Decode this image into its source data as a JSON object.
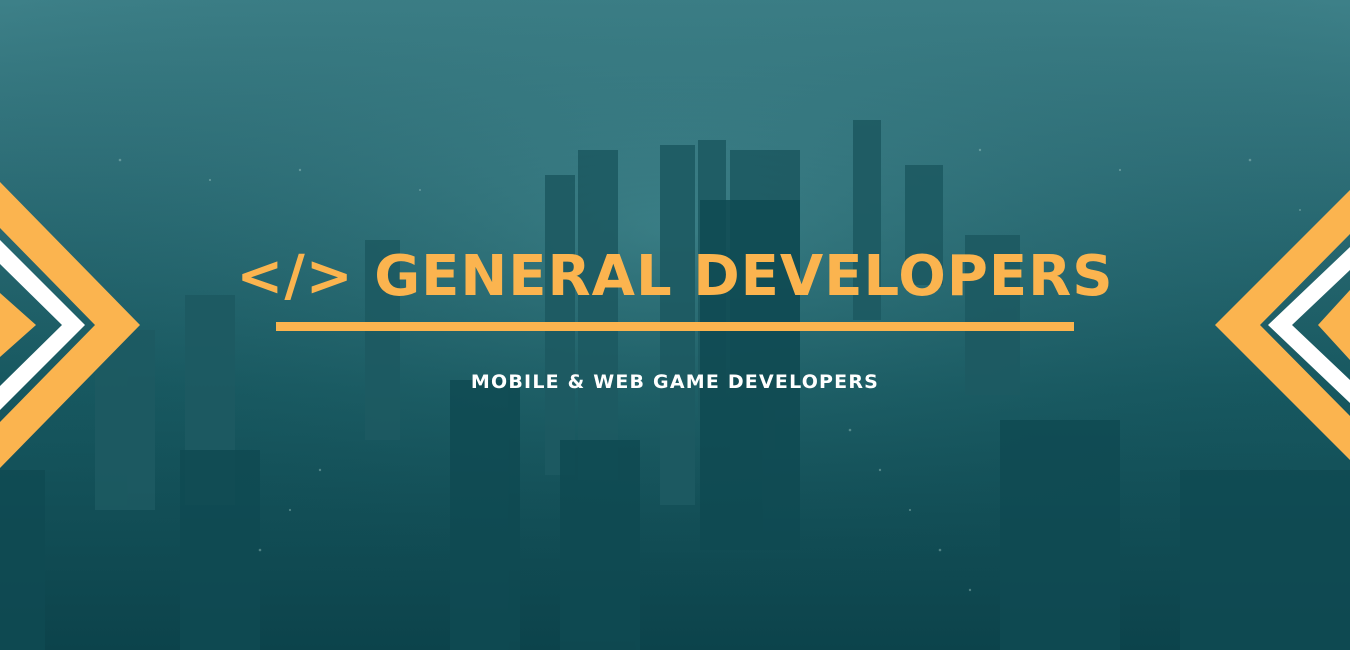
{
  "banner": {
    "title": "</> GENERAL DEVELOPERS",
    "subtitle": "MOBILE & WEB GAME DEVELOPERS"
  },
  "colors": {
    "accent": "#fbb44f",
    "overlay": "#0e4a52",
    "subtitle_text": "#ffffff",
    "chevron_white": "#ffffff"
  },
  "decorations": {
    "background": "city-skyline-photo",
    "left": "chevron-left-decoration",
    "right": "chevron-right-decoration"
  }
}
